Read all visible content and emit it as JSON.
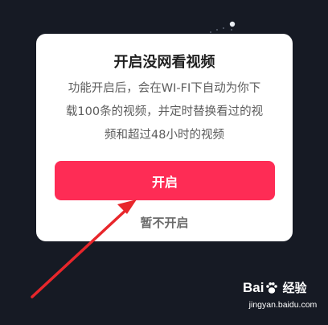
{
  "dialog": {
    "title": "开启没网看视频",
    "message_lines": [
      "功能开启后，会在WI-FI下自动为你下",
      "载100条的视频，并定时替换看过的视",
      "频和超过48小时的视频"
    ],
    "primary_button": "开启",
    "secondary_button": "暂不开启"
  },
  "watermark": {
    "brand_left": "Bai",
    "brand_right": "经验",
    "url": "jingyan.baidu.com"
  },
  "colors": {
    "background": "#161a24",
    "dialog": "#ffffff",
    "accent": "#fe2c55",
    "annotation_arrow": "#e8262b"
  }
}
